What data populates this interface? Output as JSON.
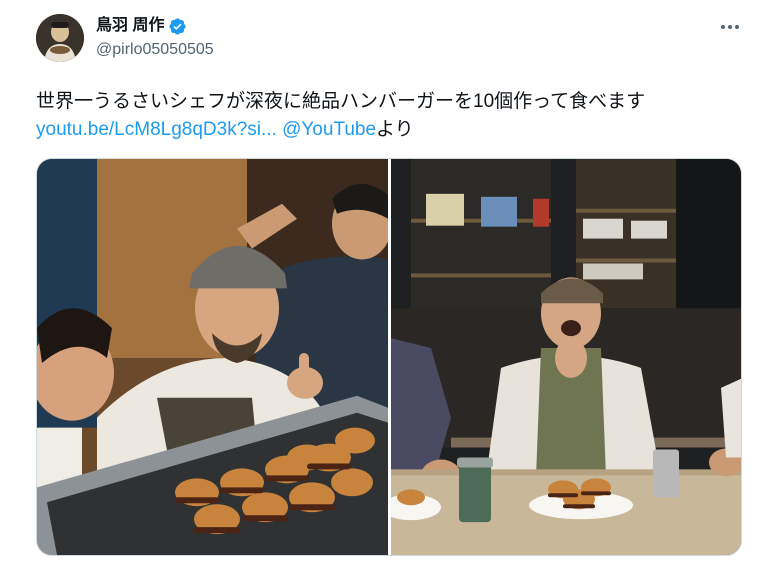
{
  "author": {
    "display_name": "鳥羽 周作",
    "handle": "@pirlo05050505",
    "verified": true,
    "verified_color": "#1d9bf0"
  },
  "tweet": {
    "text_line1": "世界一うるさいシェフが深夜に絶品ハンバーガーを10個作って食べます",
    "link_text": "youtu.be/LcM8Lg8qD3k?si...",
    "mention_text": "@YouTube",
    "trailing_text": "より"
  },
  "media": {
    "photos": [
      {
        "icon": "photo-chef-with-burgers-on-griddle"
      },
      {
        "icon": "photo-chef-laughing-with-burgers"
      }
    ]
  },
  "icons": {
    "more": "more-horizontal-icon",
    "verified": "verified-badge-icon"
  },
  "colors": {
    "link": "#1d9bf0",
    "text": "#0f1419",
    "secondary": "#536471"
  }
}
